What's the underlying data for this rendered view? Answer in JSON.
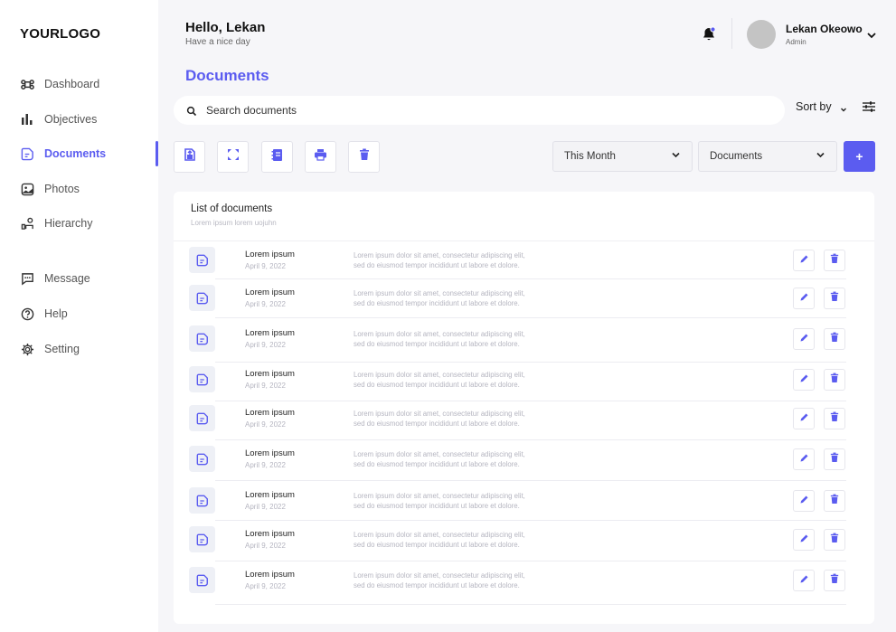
{
  "brand": {
    "logo": "YOURLOGO"
  },
  "sidebar": {
    "items": [
      {
        "label": "Dashboard",
        "icon": "command-icon"
      },
      {
        "label": "Objectives",
        "icon": "bar-chart-icon"
      },
      {
        "label": "Documents",
        "icon": "document-icon",
        "active": true
      },
      {
        "label": "Photos",
        "icon": "photo-icon"
      },
      {
        "label": "Hierarchy",
        "icon": "hierarchy-icon"
      },
      {
        "label": "Message",
        "icon": "message-icon"
      },
      {
        "label": "Help",
        "icon": "help-icon"
      },
      {
        "label": "Setting",
        "icon": "gear-icon"
      }
    ]
  },
  "header": {
    "greeting": "Hello, Lekan",
    "subgreeting": "Have a nice day",
    "user": {
      "name": "Lekan Okeowo",
      "role": "Admin"
    }
  },
  "main": {
    "title": "Documents",
    "search_placeholder": "Search documents",
    "sort_label": "Sort by",
    "filters": {
      "period": "This Month",
      "type": "Documents"
    },
    "add_label": "+"
  },
  "list": {
    "title": "List of documents",
    "subtitle": "Lorem ipsum lorem uojuhn",
    "rows": [
      {
        "name": "Lorem ipsum",
        "date": "April 9, 2022",
        "desc1": "Lorem ipsum dolor sit amet, consectetur adipiscing elit,",
        "desc2": "sed do eiusmod tempor incididunt ut labore et dolore."
      },
      {
        "name": "Lorem ipsum",
        "date": "April 9, 2022",
        "desc1": "Lorem ipsum dolor sit amet, consectetur adipiscing elit,",
        "desc2": "sed do eiusmod tempor incididunt ut labore et dolore."
      },
      {
        "name": "Lorem ipsum",
        "date": "April 9, 2022",
        "desc1": "Lorem ipsum dolor sit amet, consectetur adipiscing elit,",
        "desc2": "sed do eiusmod tempor incididunt ut labore et dolore."
      },
      {
        "name": "Lorem ipsum",
        "date": "April 9, 2022",
        "desc1": "Lorem ipsum dolor sit amet, consectetur adipiscing elit,",
        "desc2": "sed do eiusmod tempor incididunt ut labore et dolore."
      },
      {
        "name": "Lorem ipsum",
        "date": "April 9, 2022",
        "desc1": "Lorem ipsum dolor sit amet, consectetur adipiscing elit,",
        "desc2": "sed do eiusmod tempor incididunt ut labore et dolore."
      },
      {
        "name": "Lorem ipsum",
        "date": "April 9, 2022",
        "desc1": "Lorem ipsum dolor sit amet, consectetur adipiscing elit,",
        "desc2": "sed do eiusmod tempor incididunt ut labore et dolore."
      },
      {
        "name": "Lorem ipsum",
        "date": "April 9, 2022",
        "desc1": "Lorem ipsum dolor sit amet, consectetur adipiscing elit,",
        "desc2": "sed do eiusmod tempor incididunt ut labore et dolore."
      },
      {
        "name": "Lorem ipsum",
        "date": "April 9, 2022",
        "desc1": "Lorem ipsum dolor sit amet, consectetur adipiscing elit,",
        "desc2": "sed do eiusmod tempor incididunt ut labore et dolore."
      },
      {
        "name": "Lorem ipsum",
        "date": "April 9, 2022",
        "desc1": "Lorem ipsum dolor sit amet, consectetur adipiscing elit,",
        "desc2": "sed do eiusmod tempor incididunt ut labore et dolore."
      }
    ]
  },
  "colors": {
    "accent": "#5b5cf0",
    "background": "#f6f6f9",
    "notification_dot": "#5b5cf0"
  }
}
